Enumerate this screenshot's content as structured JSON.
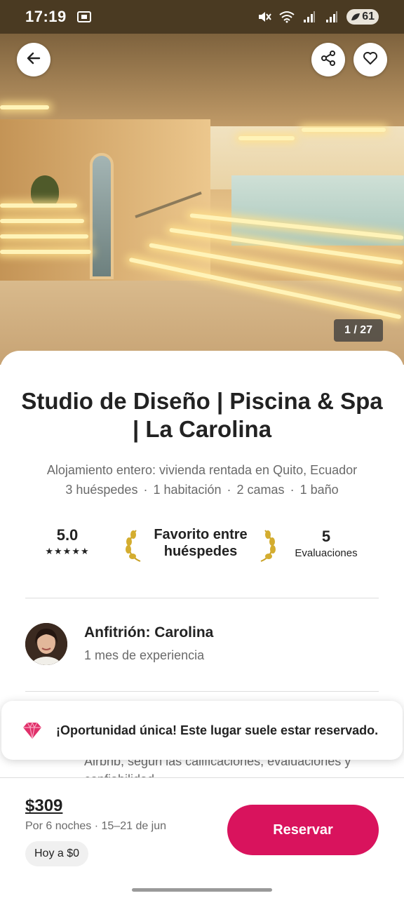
{
  "status_bar": {
    "time": "17:19",
    "battery": "61",
    "icons": [
      "screenshot-icon",
      "mute-icon",
      "wifi-icon",
      "signal-icon",
      "signal-icon"
    ]
  },
  "hero": {
    "counter": "1 / 27",
    "buttons": [
      "back-arrow-icon",
      "share-icon",
      "heart-icon"
    ]
  },
  "listing": {
    "title": "Studio de Diseño | Piscina & Spa | La Carolina",
    "subtitle": "Alojamiento entero: vivienda rentada en Quito, Ecuador",
    "details": [
      "3 huéspedes",
      "1 habitación",
      "2 camas",
      "1 baño"
    ]
  },
  "highlights": {
    "rating": "5.0",
    "stars": "★★★★★",
    "favorite_label": "Favorito entre huéspedes",
    "reviews_count": "5",
    "reviews_label": "Evaluaciones"
  },
  "host": {
    "name": "Anfitrión: Carolina",
    "experience": "1 mes de experiencia"
  },
  "behind_text": "Airbnb, según las calificaciones, evaluaciones y confiabilidad.",
  "banner": {
    "text": "¡Oportunidad única! Este lugar suele estar reservado.",
    "icon": "gem-icon"
  },
  "footer": {
    "price": "$309",
    "price_sub": "Por 6 noches · 15–21 de jun",
    "pay_today": "Hoy a $0",
    "reserve_label": "Reservar"
  },
  "colors": {
    "accent": "#d9135d",
    "text_primary": "#222222",
    "text_secondary": "#6a6a6a"
  }
}
